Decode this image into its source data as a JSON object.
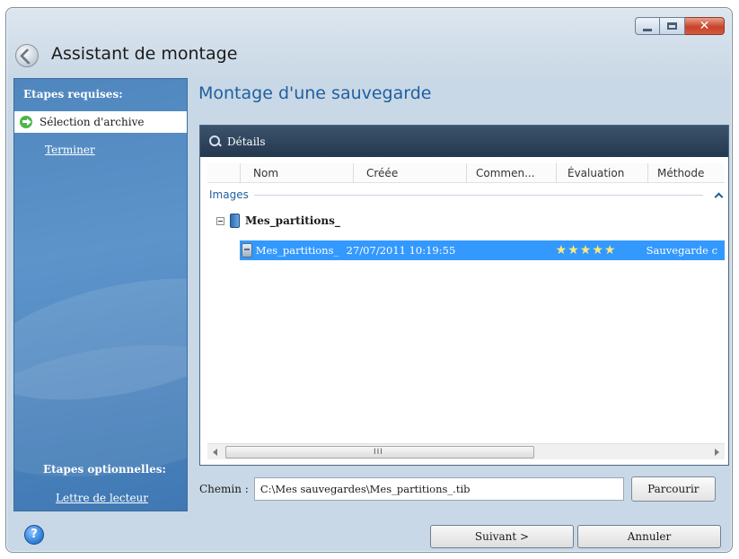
{
  "window": {
    "title": "Assistant de montage",
    "close_glyph": "✕"
  },
  "sidebar": {
    "required_heading": "Etapes requises:",
    "active_step": "Sélection d'archive",
    "finish_link": "Terminer",
    "optional_heading": "Etapes optionnelles:",
    "drive_letter_link": "Lettre de lecteur"
  },
  "main": {
    "title": "Montage d'une sauvegarde",
    "details_label": "Détails",
    "columns": [
      "Nom",
      "Créée",
      "Commen...",
      "Évaluation",
      "Méthode"
    ],
    "group_label": "Images",
    "tree_node": "Mes_partitions_",
    "selected_row": {
      "name": "Mes_partitions_",
      "created": "27/07/2011 10:19:55",
      "rating_stars": "★★★★★",
      "method": "Sauvegarde c"
    },
    "scroll_grip": "III"
  },
  "path": {
    "label": "Chemin :",
    "value": "C:\\Mes sauvegardes\\Mes_partitions_.tib",
    "browse_label": "Parcourir"
  },
  "footer": {
    "help_glyph": "?",
    "next_label": "Suivant >",
    "cancel_label": "Annuler"
  },
  "colors": {
    "accent": "#1f5f9e",
    "selection": "#3399ff",
    "sidebar": "#4f86bd"
  }
}
